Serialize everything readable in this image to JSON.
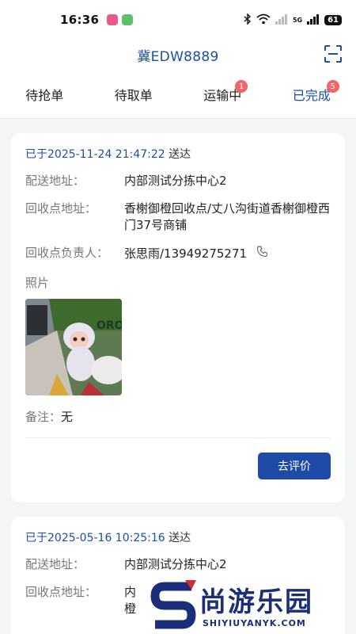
{
  "status_bar": {
    "time": "16:36",
    "network": "5G",
    "battery": "61",
    "colors": {
      "app1": "#e85a8b",
      "app2": "#5fbf6a"
    }
  },
  "header": {
    "plate": "冀EDW8889",
    "scan_icon": "scan-icon"
  },
  "tabs": [
    {
      "label": "待抢单",
      "badge": null,
      "active": false
    },
    {
      "label": "待取单",
      "badge": null,
      "active": false
    },
    {
      "label": "运输中",
      "badge": "1",
      "active": false
    },
    {
      "label": "已完成",
      "badge": "5",
      "active": true
    }
  ],
  "orders": [
    {
      "delivered_prefix": "已于2025-11-24 21:47:22",
      "delivered_suffix": " 送达",
      "delivery_label": "配送地址：",
      "delivery_value": "内部测试分拣中心2",
      "pickup_label": "回收点地址：",
      "pickup_value": "香榭御橙回收点/丈八沟街道香榭御橙西门37号商铺",
      "contact_label": "回收点负责人：",
      "contact_value": "张思雨/13949275271",
      "photo_label": "照片",
      "note_label": "备注：",
      "note_value": "无",
      "action_label": "去评价"
    },
    {
      "delivered_prefix": "已于2025-05-16 10:25:16",
      "delivered_suffix": " 送达",
      "delivery_label": "配送地址：",
      "delivery_value": "内部测试分拣中心2",
      "pickup_label": "回收点地址：",
      "pickup_value": "内",
      "pickup_value_line2": "橙"
    }
  ],
  "watermark": {
    "title": "尚游乐园",
    "url": "SHIYIUYANYK.COM"
  },
  "accent_color": "#1d4ea0"
}
